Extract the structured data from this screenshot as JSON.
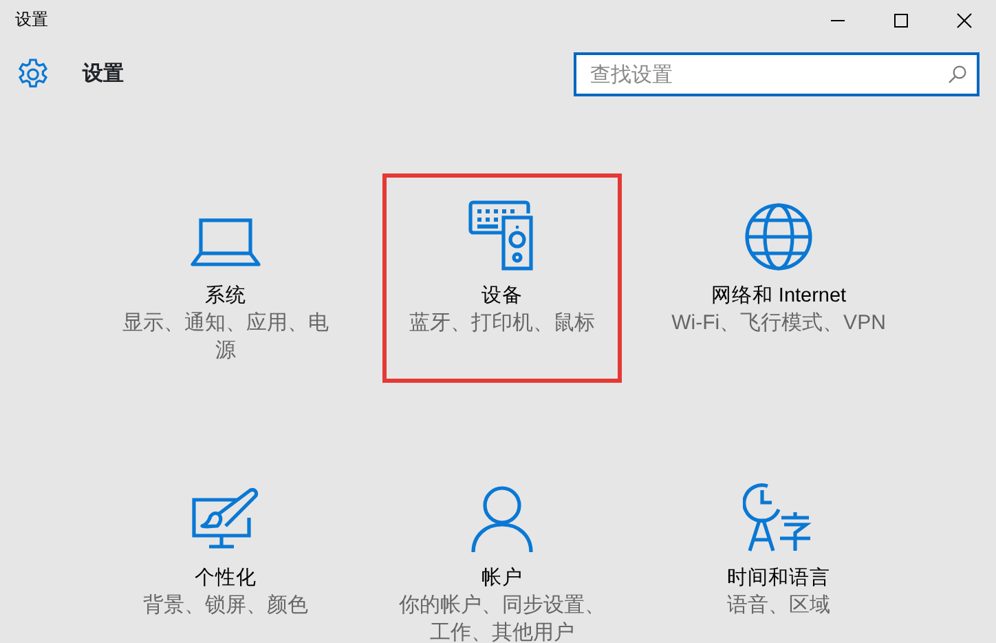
{
  "window": {
    "title": "设置"
  },
  "header": {
    "title": "设置"
  },
  "search": {
    "placeholder": "查找设置"
  },
  "tiles": [
    {
      "kind": "laptop",
      "title": "系统",
      "description": "显示、通知、应用、电源",
      "highlighted": false
    },
    {
      "kind": "devices",
      "title": "设备",
      "description": "蓝牙、打印机、鼠标",
      "highlighted": true
    },
    {
      "kind": "globe",
      "title": "网络和 Internet",
      "description": "Wi-Fi、飞行模式、VPN",
      "highlighted": false
    },
    {
      "kind": "personalize",
      "title": "个性化",
      "description": "背景、锁屏、颜色",
      "highlighted": false
    },
    {
      "kind": "person",
      "title": "帐户",
      "description": "你的帐户、同步设置、工作、其他用户",
      "highlighted": false
    },
    {
      "kind": "timelang",
      "title": "时间和语言",
      "description": "语音、区域",
      "highlighted": false
    }
  ]
}
